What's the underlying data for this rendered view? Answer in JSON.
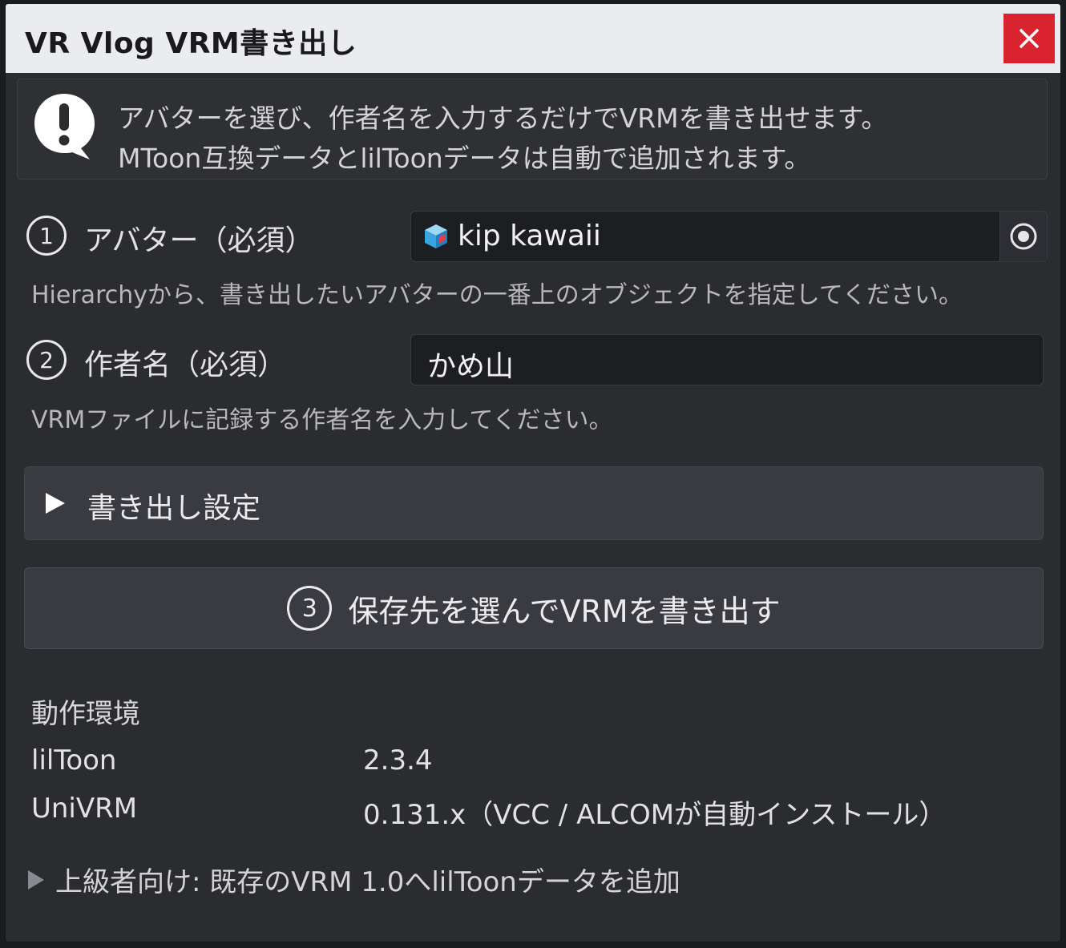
{
  "window": {
    "title": "VR Vlog VRM書き出し",
    "close_icon": "close-icon"
  },
  "info": {
    "icon": "exclamation-speech-bubble-icon",
    "line1": "アバターを選び、作者名を入力するだけでVRMを書き出せます。",
    "line2": "MToon互換データとlilToonデータは自動で追加されます。"
  },
  "avatar_field": {
    "step": "1",
    "label": "アバター（必須）",
    "value": "kip kawaii",
    "value_icon": "prefab-cube-icon",
    "picker_icon": "object-picker-icon",
    "hint": "Hierarchyから、書き出したいアバターの一番上のオブジェクトを指定してください。"
  },
  "author_field": {
    "step": "2",
    "label": "作者名（必須）",
    "value": "かめ山",
    "hint": "VRMファイルに記録する作者名を入力してください。"
  },
  "export_settings": {
    "label": "書き出し設定",
    "expanded": false
  },
  "export_button": {
    "step": "3",
    "label": "保存先を選んでVRMを書き出す"
  },
  "environment": {
    "title": "動作環境",
    "rows": [
      {
        "name": "lilToon",
        "version": "2.3.4"
      },
      {
        "name": "UniVRM",
        "version": "0.131.x（VCC / ALCOMが自動インストール）"
      }
    ]
  },
  "advanced": {
    "label": "上級者向け: 既存のVRM 1.0へlilToonデータを追加",
    "expanded": false
  },
  "colors": {
    "close": "#d9232f",
    "background": "#2b2c30",
    "titlebar": "#ebecef",
    "cube_accent": "#3aa6e0"
  }
}
